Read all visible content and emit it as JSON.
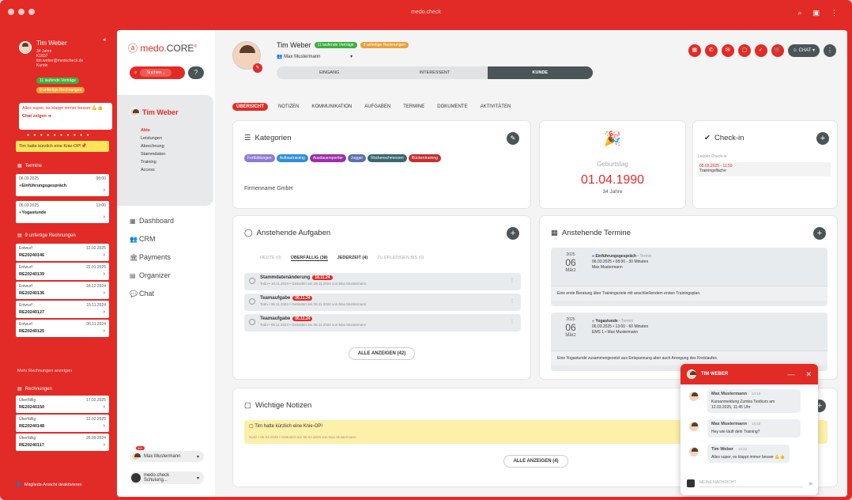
{
  "window": {
    "title": "medo.check",
    "icons": [
      "magnifier-icon",
      "layers-icon",
      "more-icon"
    ]
  },
  "sidebar": {
    "name": "Tim Weber",
    "age": "34 Jahre",
    "id": "K1837",
    "email": "tim.weber@medocheck.de",
    "role": "Kunde",
    "badge_contracts": "11 laufende Verträge",
    "badge_invoices": "9 unfertige Rechnungen",
    "chat_preview": "Alles super, es klappt immer besser 💪👍",
    "chat_link": "Chat zeigen ➔",
    "note": "Tim hatte kürzlich eine Knie-OP!📌",
    "termine_title": "Termine",
    "termine": [
      {
        "date": "06.03.2025",
        "time": "08:00",
        "label": "Einführungsgespräch",
        "color": "#3fae3f"
      },
      {
        "date": "06.03.2025",
        "time": "13:00",
        "label": "Yogastunde",
        "color": "#3fae3f"
      }
    ],
    "unf_title": "9 unfertige Rechnungen",
    "unfertig": [
      {
        "status": "Entwurf",
        "date": "12.02.2025",
        "nr": "RE20240146"
      },
      {
        "status": "Entwurf",
        "date": "22.01.2025",
        "nr": "RE20240139"
      },
      {
        "status": "Entwurf",
        "date": "18.12.2024",
        "nr": "RE20240136"
      },
      {
        "status": "Entwurf",
        "date": "15.11.2024",
        "nr": "RE20240127"
      },
      {
        "status": "Entwurf",
        "date": "06.11.2024",
        "nr": "RE20240125"
      }
    ],
    "more_link": "Mehr Rechnungen anzeigen",
    "rech_title": "Rechnungen",
    "rechnungen": [
      {
        "status": "Überfällig",
        "date": "17.02.2025",
        "nr": "RE20240150"
      },
      {
        "status": "Überfällig",
        "date": "12.02.2025",
        "nr": "RE20240148"
      },
      {
        "status": "Überfällig",
        "date": "26.09.2024",
        "nr": "RE20240117"
      }
    ],
    "footer": "Mitglieds-Ansicht deaktivieren"
  },
  "nav": {
    "brand_a": "medo.",
    "brand_b": "CORE",
    "brand_sup": "®",
    "search": "Suchen...",
    "help": "?",
    "customer": "Tim Weber",
    "sub": [
      "Akte",
      "Leistungen",
      "Abrechnung",
      "Stammdaten",
      "Training",
      "Access"
    ],
    "menu": [
      {
        "icon": "▦",
        "label": "Dashboard"
      },
      {
        "icon": "👥",
        "label": "CRM"
      },
      {
        "icon": "🏛",
        "label": "Payments"
      },
      {
        "icon": "▤",
        "label": "Organizer"
      },
      {
        "icon": "💬",
        "label": "Chat"
      }
    ],
    "user": "Max Mustermann",
    "user_badge": "99+",
    "org": "medo.check Schulung..."
  },
  "header": {
    "name": "Tim Weber",
    "badge_contracts": "11 laufende Verträge",
    "badge_invoices": "9 unfertige Rechnungen",
    "assigned": "Max Mustermann",
    "pipeline": [
      "EINGANG",
      "INTERESSENT",
      "KUNDE"
    ],
    "chat": "CHAT"
  },
  "tabs": [
    "ÜBERSICHT",
    "NOTIZEN",
    "KOMMUNIKATION",
    "AUFGABEN",
    "TERMINE",
    "DOKUMENTE",
    "AKTIVITÄTEN"
  ],
  "kategorien": {
    "title": "Kategorien",
    "chips": [
      {
        "label": "Fortbildungen",
        "color": "#8e7ad6"
      },
      {
        "label": "Aufbautraining",
        "color": "#2f8fd8"
      },
      {
        "label": "Ausdauersportler",
        "color": "#9b2fa8"
      },
      {
        "label": "Jogger",
        "color": "#5b6fb0"
      },
      {
        "label": "Rückenschmerzen",
        "color": "#3a6670"
      },
      {
        "label": "Rückentraining",
        "color": "#c62f2f"
      }
    ],
    "firma": "Firmenname GmbH"
  },
  "geburtstag": {
    "label": "Geburtstag",
    "date": "01.04.1990",
    "age": "34 Jahre"
  },
  "checkin": {
    "title": "Check-in",
    "last_label": "Letzter Check-in",
    "last_time": "05.03.2025 - 11:59",
    "last_place": "Trainingsfläche"
  },
  "aufgaben": {
    "title": "Anstehende Aufgaben",
    "filters": [
      "HEUTE (0)",
      "ÜBERFÄLLIG (38)",
      "JEDERZEIT (4)",
      "ZU ERLEDIGEN BIS (0)"
    ],
    "items": [
      {
        "title": "Stammdatenänderung",
        "due": "18.11.24",
        "meta": "Todo • 18.11.2024 • Geändert am 18.11.2024 von Max Mustermann"
      },
      {
        "title": "Teamaufgabe",
        "due": "06.11.24",
        "meta": "Todo • 06.11.2024 • Geändert am 06.11.2024 von Max Mustermann"
      },
      {
        "title": "Teamaufgabe",
        "due": "06.11.24",
        "meta": "Todo • 06.11.2024 • Geändert am 06.11.2024 von Max Mustermann"
      }
    ],
    "all": "ALLE ANZEIGEN (42)"
  },
  "termine": {
    "title": "Anstehende Termine",
    "items": [
      {
        "year": "2025",
        "day": "06",
        "month": "März",
        "title": "Einführungsgespräch",
        "type": "Termin",
        "dot": "#2f6fd8",
        "line1": "06.03.2025 • 08:00 - 30 Minuten",
        "line2": "Max Mustermann",
        "desc": "Eine erste Beratung über Trainingsziele mit anschließendem ersten Trainingsplan."
      },
      {
        "year": "2025",
        "day": "06",
        "month": "März",
        "title": "Yogastunde",
        "type": "Termin",
        "dot": "#3fae7a",
        "line1": "06.03.2025 • 13:00 - 60 Minuten",
        "line2": "EMS 1 • Max Mustermann",
        "desc": "Eine Yogastunde zusammengesetzt aus Entspannung aber auch Anregung des Kreislaufes."
      }
    ]
  },
  "notizen": {
    "title": "Wichtige Notizen",
    "note": "Tim hatte kürzlich eine Knie-OP!",
    "meta": "Notiz • 05.03.2025 • Geändert am 05.03.2025 von Max Mustermann",
    "all": "ALLE ANZEIGEN (4)"
  },
  "chat": {
    "title": "TIM WEBER",
    "msgs": [
      {
        "name": "Max Mustermann",
        "time": "14:19",
        "text": "Kursanmeldung Zumba Testkurs am 12.03.2025, 11:45 Uhr"
      },
      {
        "name": "Max Mustermann",
        "time": "14:22",
        "text": "Hey wie läuft dein Training?"
      },
      {
        "name": "Tim Weber",
        "time": "14:22",
        "text": "Alles super, es klappt immer besser 💪👍"
      }
    ],
    "placeholder": "MEINE NACHRICHT"
  }
}
